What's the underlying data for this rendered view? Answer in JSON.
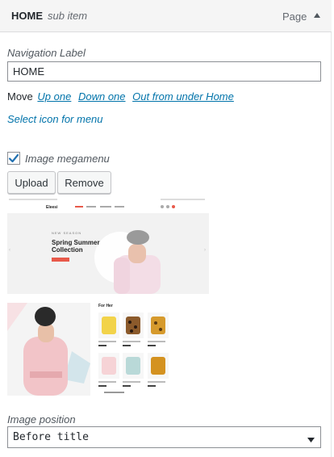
{
  "item": {
    "title": "HOME",
    "subtitle": "sub item",
    "type": "Page",
    "toggle_icon": "arrow-up-icon"
  },
  "navigation": {
    "label": "Navigation Label",
    "value": "HOME"
  },
  "move": {
    "label": "Move",
    "up": "Up one",
    "down": "Down one",
    "out": "Out from under Home"
  },
  "select_icon": "Select icon for menu",
  "megamenu": {
    "label": "Image megamenu",
    "checked": true
  },
  "buttons": {
    "upload": "Upload",
    "remove": "Remove"
  },
  "preview": {
    "logo": "Eleesi",
    "hero_kicker": "NEW SEASON",
    "hero_title_1": "Spring Summer",
    "hero_title_2": "Collection",
    "panel_title": "For Her",
    "accent_color": "#e8594a"
  },
  "image_position": {
    "label": "Image position",
    "value": "Before title"
  },
  "colors": {
    "link": "#0073aa",
    "header_bg": "#f5f5f5",
    "check": "#2271b1"
  }
}
